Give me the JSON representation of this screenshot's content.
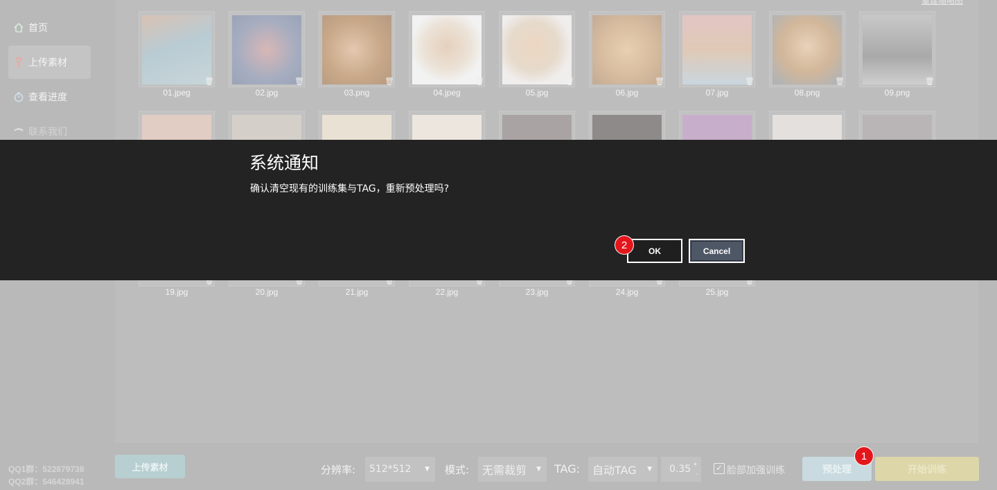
{
  "sidebar": {
    "items": [
      {
        "label": "首页",
        "icon": "home-icon"
      },
      {
        "label": "上传素材",
        "icon": "pin-icon"
      },
      {
        "label": "查看进度",
        "icon": "stopwatch-icon"
      },
      {
        "label": "联系我们",
        "icon": "phone-icon"
      }
    ],
    "qq1": "QQ1群：522879738",
    "qq2": "QQ2群：546428941"
  },
  "gallery": {
    "rebuild_link": "重建缩略图",
    "files_row1": [
      "01.jpeg",
      "02.jpg",
      "03.png",
      "04.jpeg",
      "05.jpg",
      "06.jpg",
      "07.jpg",
      "08.png",
      "09.png"
    ],
    "files_row3": [
      "19.jpg",
      "20.jpg",
      "21.jpg",
      "22.jpg",
      "23.jpg",
      "24.jpg",
      "25.jpg"
    ]
  },
  "toolbar": {
    "upload_label": "上传素材",
    "resolution_label": "分辨率:",
    "resolution_value": "512*512",
    "mode_label": "模式:",
    "mode_value": "无需裁剪",
    "tag_label": "TAG:",
    "tag_value": "自动TAG",
    "threshold_value": "0.35",
    "face_enhance_label": "脸部加强训练",
    "preprocess_label": "预处理",
    "train_label": "开始训练",
    "marker1": "1"
  },
  "dialog": {
    "title": "系统通知",
    "message": "确认清空现有的训练集与TAG，重新预处理吗?",
    "ok_label": "OK",
    "cancel_label": "Cancel",
    "marker2": "2"
  },
  "colors": {
    "overlay": "#b9b9b9",
    "dialog_bg": "#232323",
    "marker": "#e4161c"
  }
}
